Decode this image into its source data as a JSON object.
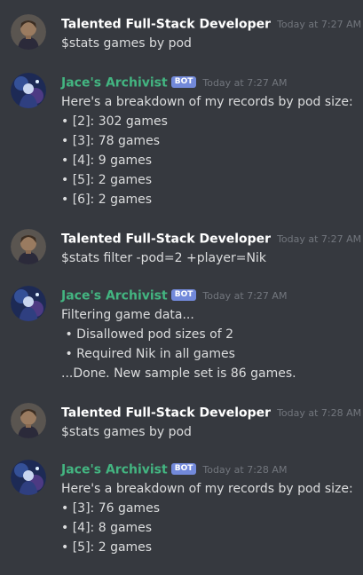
{
  "colors": {
    "background": "#36393f",
    "user_name": "#ffffff",
    "bot_name": "#43b581",
    "bot_tag": "#7289da",
    "timestamp": "#72767d",
    "text": "#dcddde"
  },
  "messages": [
    {
      "author": "Talented Full-Stack Developer",
      "is_bot": false,
      "timestamp": "Today at 7:27 AM",
      "lines": [
        "$stats games by pod"
      ]
    },
    {
      "author": "Jace's Archivist",
      "is_bot": true,
      "bot_tag": "BOT",
      "timestamp": "Today at 7:27 AM",
      "lines": [
        "Here's a breakdown of my records by pod size:",
        "• [2]: 302 games",
        "• [3]: 78 games",
        "• [4]: 9 games",
        "• [5]: 2 games",
        "• [6]: 2 games"
      ]
    },
    {
      "author": "Talented Full-Stack Developer",
      "is_bot": false,
      "timestamp": "Today at 7:27 AM",
      "lines": [
        "$stats filter -pod=2 +player=Nik"
      ]
    },
    {
      "author": "Jace's Archivist",
      "is_bot": true,
      "bot_tag": "BOT",
      "timestamp": "Today at 7:27 AM",
      "lines": [
        "Filtering game data...",
        " • Disallowed pod sizes of 2",
        " • Required Nik in all games",
        "...Done. New sample set is 86 games."
      ]
    },
    {
      "author": "Talented Full-Stack Developer",
      "is_bot": false,
      "timestamp": "Today at 7:28 AM",
      "lines": [
        "$stats games by pod"
      ]
    },
    {
      "author": "Jace's Archivist",
      "is_bot": true,
      "bot_tag": "BOT",
      "timestamp": "Today at 7:28 AM",
      "lines": [
        "Here's a breakdown of my records by pod size:",
        "• [3]: 76 games",
        "• [4]: 8 games",
        "• [5]: 2 games"
      ]
    }
  ]
}
